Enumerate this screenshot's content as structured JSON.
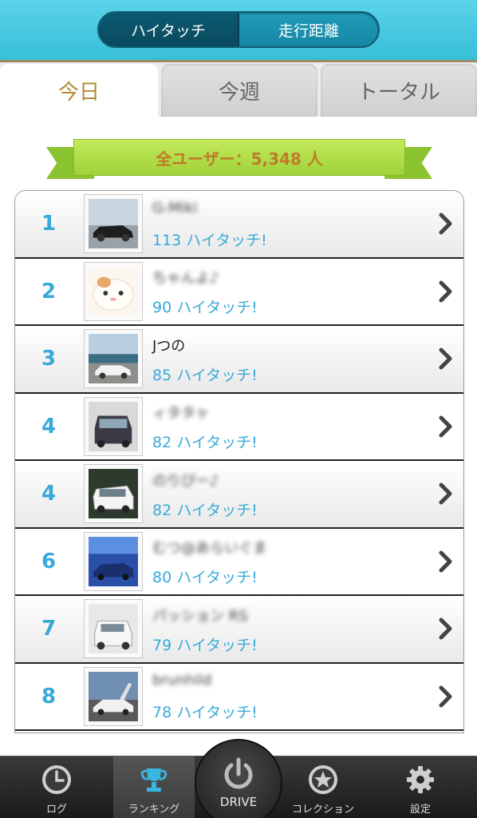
{
  "header": {
    "segments": [
      "ハイタッチ",
      "走行距離"
    ]
  },
  "tabs": [
    "今日",
    "今週",
    "トータル"
  ],
  "banner": "全ユーザー：5,348 人",
  "rows": [
    {
      "rank": "1",
      "name": "G-Miki",
      "hits": "113 ハイタッチ!"
    },
    {
      "rank": "2",
      "name": "ちゃんよ♪",
      "hits": "90 ハイタッチ!"
    },
    {
      "rank": "3",
      "name": "Jつの",
      "hits": "85 ハイタッチ!"
    },
    {
      "rank": "4",
      "name": "ィタタヶ",
      "hits": "82 ハイタッチ!"
    },
    {
      "rank": "4",
      "name": "のりぴー♪",
      "hits": "82 ハイタッチ!"
    },
    {
      "rank": "6",
      "name": "むつ@あらいぐま",
      "hits": "80 ハイタッチ!"
    },
    {
      "rank": "7",
      "name": "パッション RS",
      "hits": "79 ハイタッチ!"
    },
    {
      "rank": "8",
      "name": "brunhild",
      "hits": "78 ハイタッチ!"
    }
  ],
  "nav": {
    "log": "ログ",
    "ranking": "ランキング",
    "drive": "DRIVE",
    "collection": "コレクション",
    "settings": "設定"
  },
  "colors": {
    "accent": "#39a9d9",
    "header": "#4ccbe3",
    "ribbon": "#a7d83f",
    "active_tab_text": "#b48a33"
  }
}
